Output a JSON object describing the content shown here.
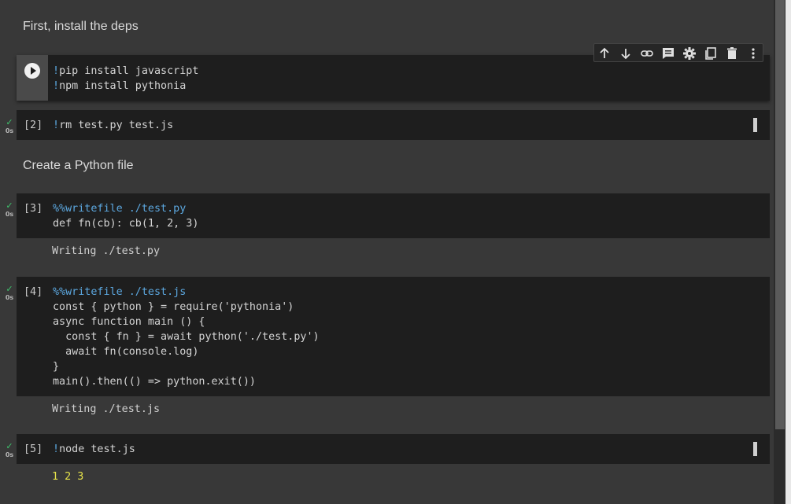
{
  "cells": {
    "md_1": "First, install the deps",
    "cell_1": {
      "lines": [
        "!pip install javascript",
        "!npm install pythonia"
      ]
    },
    "cell_2": {
      "count": "[2]",
      "status_duration": "0s",
      "code": "rm test.py test.js",
      "bang": "!"
    },
    "md_2": "Create a Python file",
    "cell_3": {
      "count": "[3]",
      "status_duration": "0s",
      "magic": "%%writefile ./test.py",
      "line2": "def fn(cb): cb(1, 2, 3)",
      "output": "Writing ./test.py"
    },
    "cell_4": {
      "count": "[4]",
      "status_duration": "0s",
      "magic": "%%writefile ./test.js",
      "lines": [
        "const { python } = require('pythonia')",
        "async function main () {",
        "  const { fn } = await python('./test.py')",
        "  await fn(console.log)",
        "}",
        "main().then(() => python.exit())"
      ],
      "output": "Writing ./test.js"
    },
    "cell_5": {
      "count": "[5]",
      "status_duration": "0s",
      "bang": "!",
      "code": "node test.js",
      "output": "1 2 3"
    }
  },
  "toolbar": {
    "buttons": [
      {
        "icon": "arrow-up-icon"
      },
      {
        "icon": "arrow-down-icon"
      },
      {
        "icon": "link-icon"
      },
      {
        "icon": "comment-icon"
      },
      {
        "icon": "gear-icon"
      },
      {
        "icon": "mirror-cell-icon"
      },
      {
        "icon": "trash-icon"
      },
      {
        "icon": "more-vert-icon"
      }
    ]
  },
  "colors": {
    "background": "#383838",
    "cell_bg": "#1e1e1e",
    "magic": "#5ca8e0",
    "check": "#3ec46d",
    "output_yellow": "#e6e34a"
  }
}
